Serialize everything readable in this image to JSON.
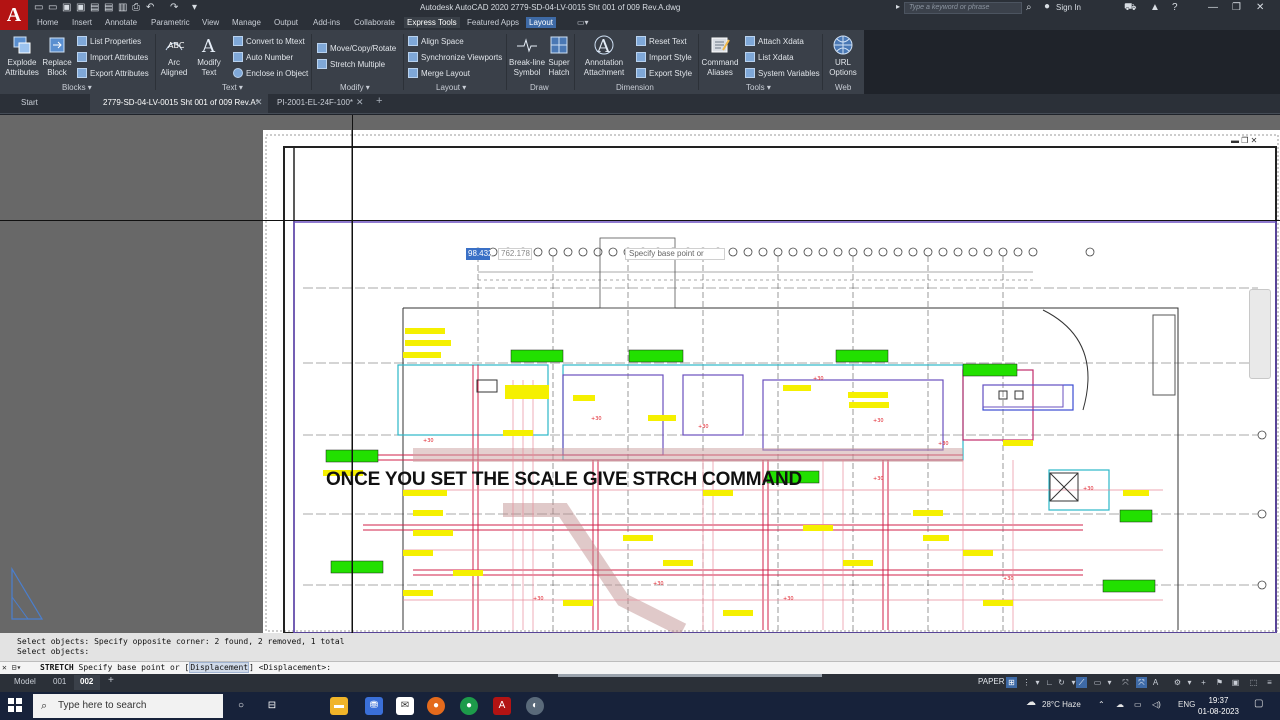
{
  "titlebar": {
    "app_logo": "A",
    "title": "Autodesk AutoCAD 2020    2779-SD-04-LV-0015 Sht 001 of 009 Rev.A.dwg",
    "search_placeholder": "Type a keyword or phrase",
    "sign_in": "Sign In"
  },
  "ribbon_tabs": [
    "Home",
    "Insert",
    "Annotate",
    "Parametric",
    "View",
    "Manage",
    "Output",
    "Add-ins",
    "Collaborate",
    "Express Tools",
    "Featured Apps",
    "Layout"
  ],
  "ribbon": {
    "blocks": {
      "title": "Blocks",
      "explode_attributes": "Explode\nAttributes",
      "replace_block": "Replace\nBlock",
      "list_properties": "List Properties",
      "import_attributes": "Import Attributes",
      "export_attributes": "Export Attributes"
    },
    "text": {
      "title": "Text",
      "arc_aligned": "Arc\nAligned",
      "modify_text": "Modify\nText",
      "convert_to_mtext": "Convert to Mtext",
      "auto_number": "Auto Number",
      "enclose_in_object": "Enclose in Object"
    },
    "modify": {
      "title": "Modify",
      "move_copy_rotate": "Move/Copy/Rotate",
      "stretch_multiple": "Stretch Multiple"
    },
    "layout": {
      "title": "Layout",
      "align_space": "Align Space",
      "synchronize_viewports": "Synchronize Viewports",
      "merge_layout": "Merge Layout"
    },
    "draw": {
      "title": "Draw",
      "break_line_symbol": "Break-line\nSymbol",
      "super_hatch": "Super\nHatch"
    },
    "dimension": {
      "title": "Dimension",
      "annotation_attachment": "Annotation\nAttachment",
      "reset_text": "Reset Text",
      "import_style": "Import Style",
      "export_style": "Export Style"
    },
    "tools": {
      "title": "Tools",
      "command_aliases": "Command\nAliases",
      "attach_xdata": "Attach Xdata",
      "list_xdata": "List Xdata",
      "system_variables": "System Variables"
    },
    "web": {
      "title": "Web",
      "url_options": "URL\nOptions"
    }
  },
  "file_tabs": {
    "start": "Start",
    "active": "2779-SD-04-LV-0015 Sht 001 of 009 Rev.A*",
    "second": "PI-2001-EL-24F-100*"
  },
  "drawing": {
    "caption": "ONCE YOU SET THE SCALE GIVE STRCH COMMAND",
    "dynamic_input": {
      "prompt": "Specify base point or",
      "value1": "98.432",
      "value2": "762.178"
    }
  },
  "command": {
    "history_line1": "Select objects: Specify opposite corner: 2 found, 2 removed, 1 total",
    "history_line2": "Select objects:",
    "command_name": "STRETCH",
    "prompt_pre": "Specify base point or [",
    "option": "Displacement",
    "prompt_post": "] <Displacement>:"
  },
  "layout_tabs": [
    "Model",
    "001",
    "002"
  ],
  "status": {
    "space": "PAPER"
  },
  "taskbar": {
    "search_placeholder": "Type here to search",
    "weather": "28°C  Haze",
    "language": "ENG",
    "time": "19:37",
    "date": "01-08-2023"
  },
  "colors": {
    "accent": "#3e6aa6",
    "autocad_red": "#b31313"
  }
}
